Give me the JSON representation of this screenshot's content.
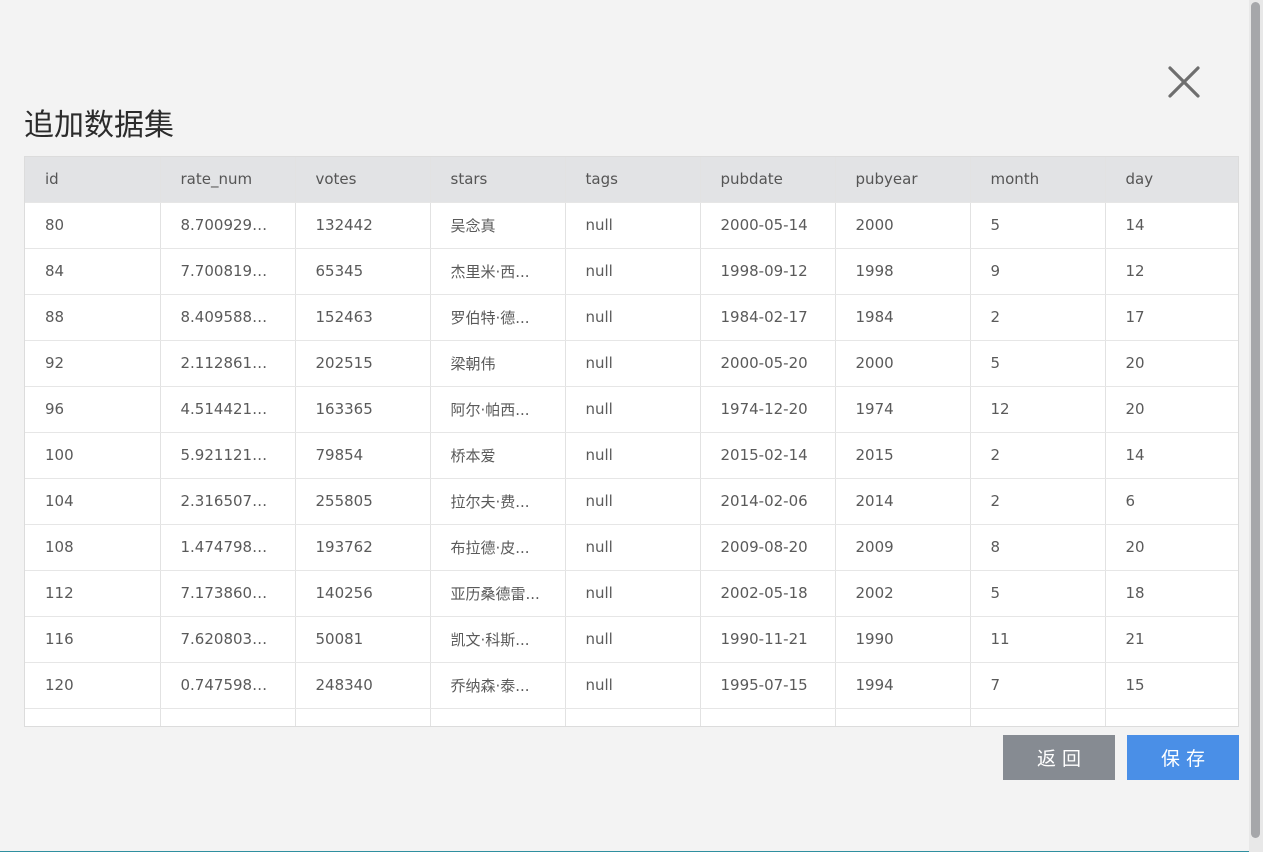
{
  "dialog": {
    "title": "追加数据集",
    "close_icon": "close-icon",
    "back_label": "返回",
    "save_label": "保存"
  },
  "table": {
    "columns": [
      "id",
      "rate_num",
      "votes",
      "stars",
      "tags",
      "pubdate",
      "pubyear",
      "month",
      "day"
    ],
    "rows": [
      [
        "80",
        "8.70092988...",
        "132442",
        "吴念真",
        "null",
        "2000-05-14",
        "2000",
        "5",
        "14"
      ],
      [
        "84",
        "7.70081954...",
        "65345",
        "杰里米·西...",
        "null",
        "1998-09-12",
        "1998",
        "9",
        "12"
      ],
      [
        "88",
        "8.40958884...",
        "152463",
        "罗伯特·德...",
        "null",
        "1984-02-17",
        "1984",
        "2",
        "17"
      ],
      [
        "92",
        "2.11286133...",
        "202515",
        "梁朝伟",
        "null",
        "2000-05-20",
        "2000",
        "5",
        "20"
      ],
      [
        "96",
        "4.51442149...",
        "163365",
        "阿尔·帕西...",
        "null",
        "1974-12-20",
        "1974",
        "12",
        "20"
      ],
      [
        "100",
        "5.92112170...",
        "79854",
        "桥本爱",
        "null",
        "2015-02-14",
        "2015",
        "2",
        "14"
      ],
      [
        "104",
        "2.31650741...",
        "255805",
        "拉尔夫·费...",
        "null",
        "2014-02-06",
        "2014",
        "2",
        "6"
      ],
      [
        "108",
        "1.47479885...",
        "193762",
        "布拉德·皮...",
        "null",
        "2009-08-20",
        "2009",
        "8",
        "20"
      ],
      [
        "112",
        "7.17386078...",
        "140256",
        "亚历桑德雷...",
        "null",
        "2002-05-18",
        "2002",
        "5",
        "18"
      ],
      [
        "116",
        "7.62080371...",
        "50081",
        "凯文·科斯...",
        "null",
        "1990-11-21",
        "1990",
        "11",
        "21"
      ],
      [
        "120",
        "0.74759809...",
        "248340",
        "乔纳森·泰...",
        "null",
        "1995-07-15",
        "1994",
        "7",
        "15"
      ],
      [
        "",
        "",
        "",
        "",
        "",
        "",
        "",
        "",
        ""
      ]
    ]
  },
  "colors": {
    "back_button": "#868b92",
    "save_button": "#4a8fe7",
    "header_bg": "#e2e3e5"
  }
}
